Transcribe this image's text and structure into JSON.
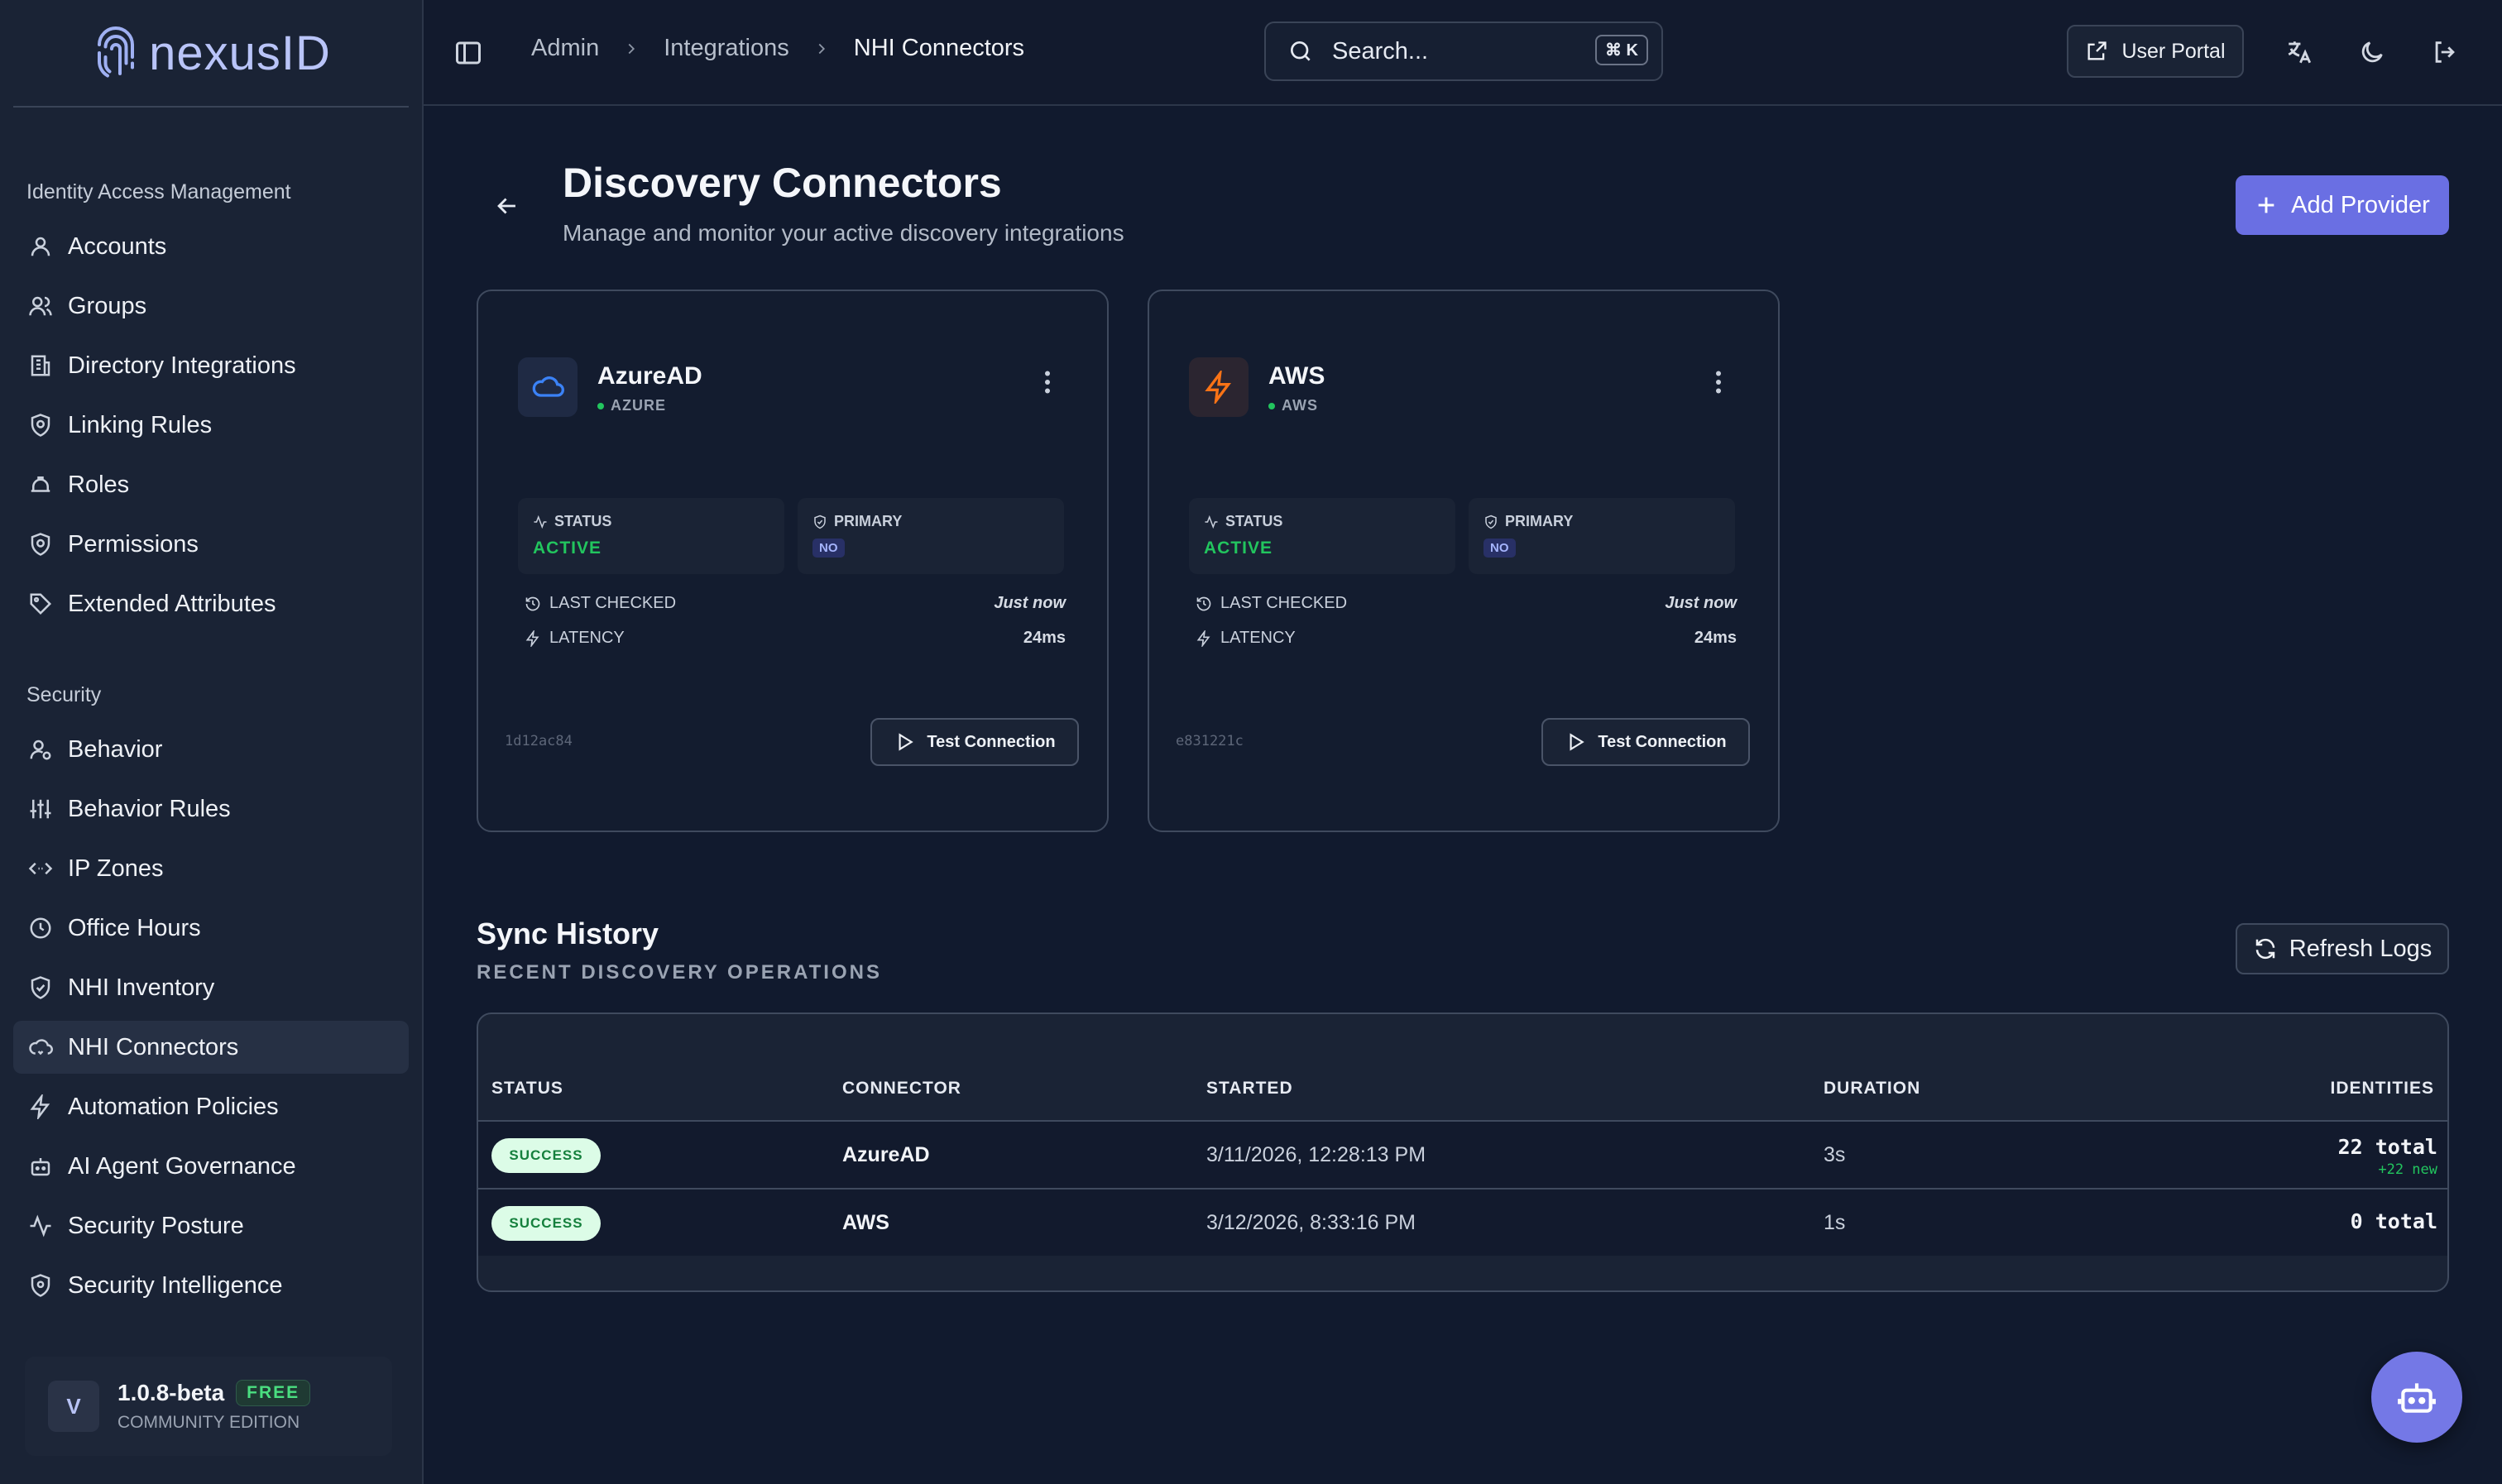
{
  "app": {
    "name": "nexusID"
  },
  "sidebar": {
    "sections": [
      {
        "label": "Identity Access Management",
        "items": [
          {
            "label": "Accounts",
            "icon": "user-icon"
          },
          {
            "label": "Groups",
            "icon": "users-icon"
          },
          {
            "label": "Directory Integrations",
            "icon": "building-icon"
          },
          {
            "label": "Linking Rules",
            "icon": "gear-shield-icon"
          },
          {
            "label": "Roles",
            "icon": "hat-icon"
          },
          {
            "label": "Permissions",
            "icon": "gear-shield-icon"
          },
          {
            "label": "Extended Attributes",
            "icon": "tag-icon"
          }
        ]
      },
      {
        "label": "Security",
        "items": [
          {
            "label": "Behavior",
            "icon": "user-gear-icon"
          },
          {
            "label": "Behavior Rules",
            "icon": "sliders-icon"
          },
          {
            "label": "IP Zones",
            "icon": "code-arrows-icon"
          },
          {
            "label": "Office Hours",
            "icon": "clock-icon"
          },
          {
            "label": "NHI Inventory",
            "icon": "shield-check-icon"
          },
          {
            "label": "NHI Connectors",
            "icon": "cloud-link-icon",
            "active": true
          },
          {
            "label": "Automation Policies",
            "icon": "zap-icon"
          },
          {
            "label": "AI Agent Governance",
            "icon": "bot-icon"
          },
          {
            "label": "Security Posture",
            "icon": "activity-icon"
          },
          {
            "label": "Security Intelligence",
            "icon": "shield-alert-icon"
          }
        ]
      }
    ],
    "version": {
      "avatar": "V",
      "label": "1.0.8-beta",
      "badge": "FREE",
      "edition": "COMMUNITY EDITION"
    }
  },
  "header": {
    "breadcrumb": [
      "Admin",
      "Integrations",
      "NHI Connectors"
    ],
    "search_placeholder": "Search...",
    "search_shortcut": "⌘ K",
    "user_portal_label": "User Portal"
  },
  "main": {
    "title": "Discovery Connectors",
    "subtitle": "Manage and monitor your active discovery integrations",
    "add_button": "Add Provider",
    "connectors": [
      {
        "name": "AzureAD",
        "type": "AZURE",
        "status_label": "STATUS",
        "status": "ACTIVE",
        "primary_label": "PRIMARY",
        "primary": "NO",
        "last_checked_label": "LAST CHECKED",
        "last_checked": "Just now",
        "latency_label": "LATENCY",
        "latency": "24ms",
        "id": "1d12ac84",
        "test_button": "Test Connection",
        "accent": "#3b82f6"
      },
      {
        "name": "AWS",
        "type": "AWS",
        "status_label": "STATUS",
        "status": "ACTIVE",
        "primary_label": "PRIMARY",
        "primary": "NO",
        "last_checked_label": "LAST CHECKED",
        "last_checked": "Just now",
        "latency_label": "LATENCY",
        "latency": "24ms",
        "id": "e831221c",
        "test_button": "Test Connection",
        "accent": "#f97316"
      }
    ],
    "sync": {
      "title": "Sync History",
      "subtitle": "RECENT DISCOVERY OPERATIONS",
      "refresh_button": "Refresh Logs",
      "columns": [
        "STATUS",
        "CONNECTOR",
        "STARTED",
        "DURATION",
        "IDENTITIES"
      ],
      "rows": [
        {
          "status": "SUCCESS",
          "connector": "AzureAD",
          "started": "3/11/2026, 12:28:13 PM",
          "duration": "3s",
          "total": "22 total",
          "new": "+22 new"
        },
        {
          "status": "SUCCESS",
          "connector": "AWS",
          "started": "3/12/2026, 8:33:16 PM",
          "duration": "1s",
          "total": "0 total",
          "new": ""
        }
      ]
    }
  }
}
